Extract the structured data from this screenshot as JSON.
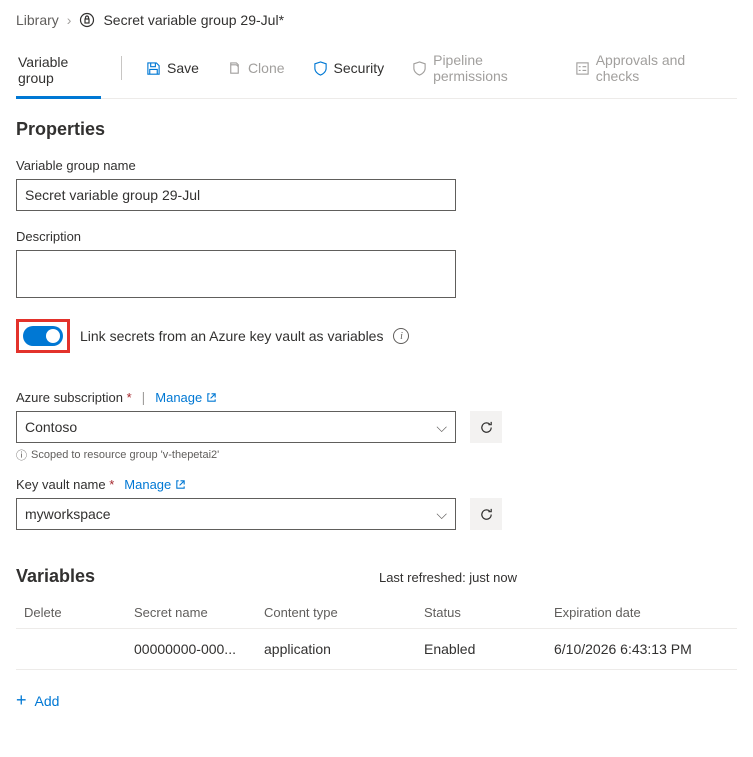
{
  "breadcrumb": {
    "library": "Library",
    "title": "Secret variable group 29-Jul*"
  },
  "tabs": {
    "variable_group": "Variable group"
  },
  "toolbar": {
    "save": "Save",
    "clone": "Clone",
    "security": "Security",
    "pipeline_permissions": "Pipeline permissions",
    "approvals": "Approvals and checks"
  },
  "properties": {
    "heading": "Properties",
    "name_label": "Variable group name",
    "name_value": "Secret variable group 29-Jul",
    "description_label": "Description",
    "description_value": "",
    "link_label": "Link secrets from an Azure key vault as variables"
  },
  "azure": {
    "subscription_label": "Azure subscription",
    "manage": "Manage",
    "subscription_value": "Contoso",
    "scope_note": "Scoped to resource group 'v-thepetai2'",
    "keyvault_label": "Key vault name",
    "keyvault_value": "myworkspace"
  },
  "variables": {
    "heading": "Variables",
    "last_refreshed": "Last refreshed: just now",
    "columns": {
      "delete": "Delete",
      "secret_name": "Secret name",
      "content_type": "Content type",
      "status": "Status",
      "expiration": "Expiration date"
    },
    "rows": [
      {
        "secret_name": "00000000-000...",
        "content_type": "application",
        "status": "Enabled",
        "expiration": "6/10/2026 6:43:13 PM"
      }
    ],
    "add": "Add"
  }
}
